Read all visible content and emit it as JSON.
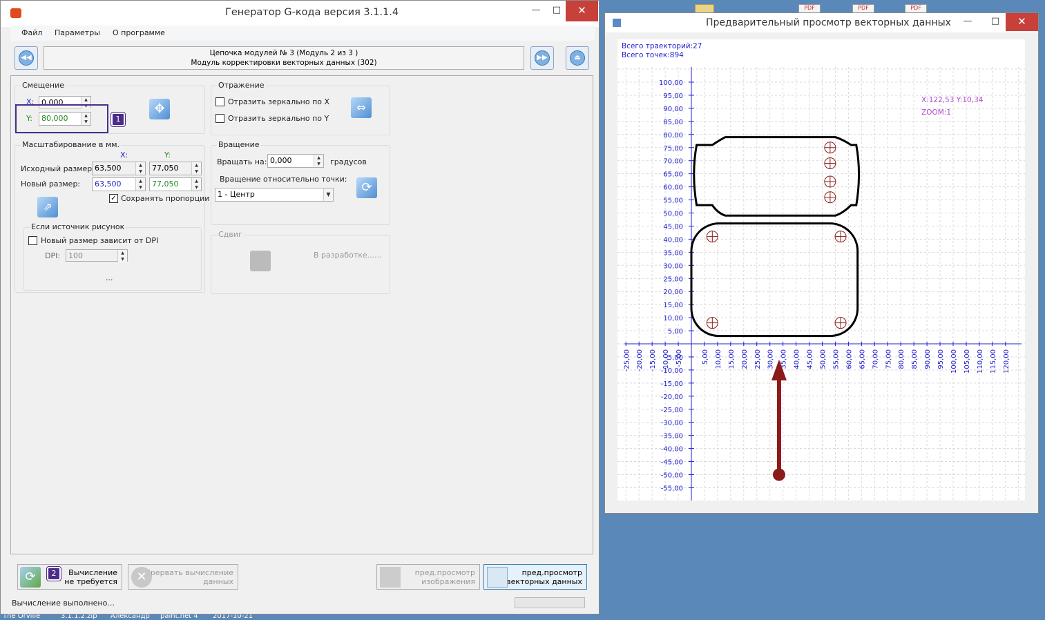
{
  "main_window": {
    "title": "Генератор G-кода версия 3.1.1.4",
    "menu": [
      "Файл",
      "Параметры",
      "О программе"
    ],
    "chain_line1": "Цепочка модулей № 3 (Модуль 2 из 3 )",
    "chain_line2": "Модуль корректировки векторных данных (302)",
    "offset": {
      "title": "Смещение",
      "x_label": "X:",
      "x_value": "0,000",
      "y_label": "Y:",
      "y_value": "80,000",
      "badge": "1"
    },
    "mirror": {
      "title": "Отражение",
      "x_label": "Отразить зеркально по X",
      "y_label": "Отразить зеркально по Y"
    },
    "scale": {
      "title": "Масштабирование в мм.",
      "col_x": "X:",
      "col_y": "Y:",
      "src_label": "Исходный размер:",
      "src_x": "63,500",
      "src_y": "77,050",
      "new_label": "Новый размер:",
      "new_x": "63,500",
      "new_y": "77,050",
      "keep_label": "Сохранять пропорции"
    },
    "rotation": {
      "title": "Вращение",
      "rotate_label": "Вращать на:",
      "rotate_value": "0,000",
      "unit": "градусов",
      "relative_label": "Вращение относительно точки:",
      "point_value": "1 - Центр"
    },
    "dpi_group": {
      "title": "Если источник рисунок",
      "dpi_check": "Новый размер зависит от DPI",
      "dpi_label": "DPI:",
      "dpi_value": "100",
      "ellipsis": "..."
    },
    "shift": {
      "title": "Сдвиг",
      "status": "В разработке......"
    },
    "buttons": {
      "calc_line1": "Вычисление",
      "calc_line2": "не требуется",
      "calc_badge": "2",
      "abort_line1": "Прервать вычисление",
      "abort_line2": "данных",
      "img_line1": "пред.просмотр",
      "img_line2": "изображения",
      "vec_line1": "пред.просмотр",
      "vec_line2": "векторных данных"
    },
    "status": "Вычисление выполнено..."
  },
  "preview_window": {
    "title": "Предварительный просмотр векторных данных",
    "total_paths": "Всего траекторий:27",
    "total_points": "Всего точек:894",
    "coord": "X:122,53 Y:10,34",
    "zoom": "ZOOM:1",
    "y_ticks": [
      "100,00",
      "95,00",
      "90,00",
      "85,00",
      "80,00",
      "75,00",
      "70,00",
      "65,00",
      "60,00",
      "55,00",
      "50,00",
      "45,00",
      "40,00",
      "35,00",
      "30,00",
      "25,00",
      "20,00",
      "15,00",
      "10,00",
      "5,00",
      "-5,00",
      "-10,00",
      "-15,00",
      "-20,00",
      "-25,00",
      "-30,00",
      "-35,00",
      "-40,00",
      "-45,00",
      "-50,00",
      "-55,00"
    ],
    "x_ticks": [
      "-25,00",
      "-20,00",
      "-15,00",
      "-10,00",
      "-5,00",
      "5,00",
      "10,00",
      "15,00",
      "20,00",
      "25,00",
      "30,00",
      "35,00",
      "40,00",
      "45,00",
      "50,00",
      "55,00",
      "60,00",
      "65,00",
      "70,00",
      "75,00",
      "80,00",
      "85,00",
      "90,00",
      "95,00",
      "100,00",
      "105,00",
      "110,00",
      "115,00",
      "120,00"
    ]
  },
  "desktop": {
    "bottom_labels": [
      "The Orville",
      "3.1.1.2.zip",
      "Александр",
      "paint.net 4",
      "2017-10-21"
    ],
    "pdf_label": "PDF"
  },
  "colors": {
    "axis": "#1f1fd0",
    "accent": "#4c2c8a",
    "arrow": "#8b1a1a",
    "coord": "#b24bd0"
  }
}
